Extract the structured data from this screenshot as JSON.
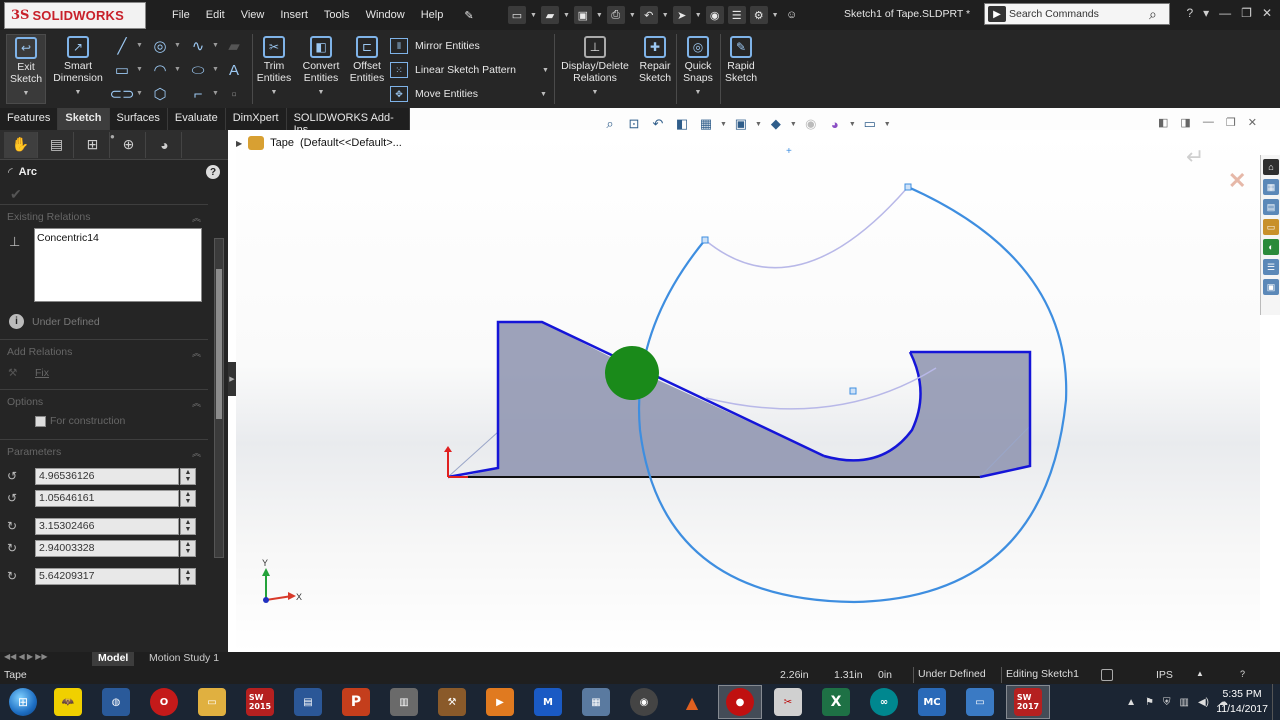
{
  "app": {
    "logo_prefix": "3S",
    "logo_text": "SOLIDWORKS",
    "menus": [
      "File",
      "Edit",
      "View",
      "Insert",
      "Tools",
      "Window",
      "Help"
    ],
    "document_title": "Sketch1 of Tape.SLDPRT *",
    "search_placeholder": "Search Commands"
  },
  "command_manager": {
    "exit_sketch": "Exit Sketch",
    "smart_dimension": "Smart Dimension",
    "trim_entities": "Trim Entities",
    "convert_entities": "Convert Entities",
    "offset_entities": "Offset Entities",
    "mirror_entities": "Mirror Entities",
    "linear_sketch_pattern": "Linear Sketch Pattern",
    "move_entities": "Move Entities",
    "display_delete_relations": "Display/Delete Relations",
    "repair_sketch": "Repair Sketch",
    "quick_snaps": "Quick Snaps",
    "rapid_sketch": "Rapid Sketch"
  },
  "tabs": [
    "Features",
    "Sketch",
    "Surfaces",
    "Evaluate",
    "DimXpert",
    "SOLIDWORKS Add-Ins"
  ],
  "active_tab": "Sketch",
  "property_manager": {
    "title": "Arc",
    "existing_relations": "Existing Relations",
    "relations": [
      "Concentric14"
    ],
    "status": "Under Defined",
    "add_relations": "Add Relations",
    "fix": "Fix",
    "options": "Options",
    "for_construction": "For construction",
    "parameters": "Parameters",
    "param_values": [
      "4.96536126",
      "1.05646161",
      "3.15302466",
      "2.94003328",
      "5.64209317"
    ]
  },
  "viewport": {
    "tree_item": "Tape",
    "tree_item_config": "(Default<<Default>..."
  },
  "bottom_tabs": [
    "Model",
    "Motion Study 1"
  ],
  "status_bar": {
    "part": "Tape",
    "x": "2.26in",
    "y": "1.31in",
    "z": "0in",
    "state": "Under Defined",
    "editing": "Editing Sketch1",
    "units": "IPS"
  },
  "taskbar": {
    "apps": [
      "sw2015",
      "ppt",
      "sw2017"
    ],
    "sw2015_label": "SW\n2015",
    "sw2017_label": "SW\n2017",
    "ppt_label": "P",
    "excel_label": "X",
    "mc_label": "MC",
    "time": "5:35 PM",
    "date": "11/14/2017"
  },
  "colors": {
    "sketch_blue": "#1515d8",
    "arc_blue": "#3e8ee0",
    "region_fill": "#8f95b0",
    "green_dot": "#1a8a1a",
    "origin_red": "#e02020"
  }
}
